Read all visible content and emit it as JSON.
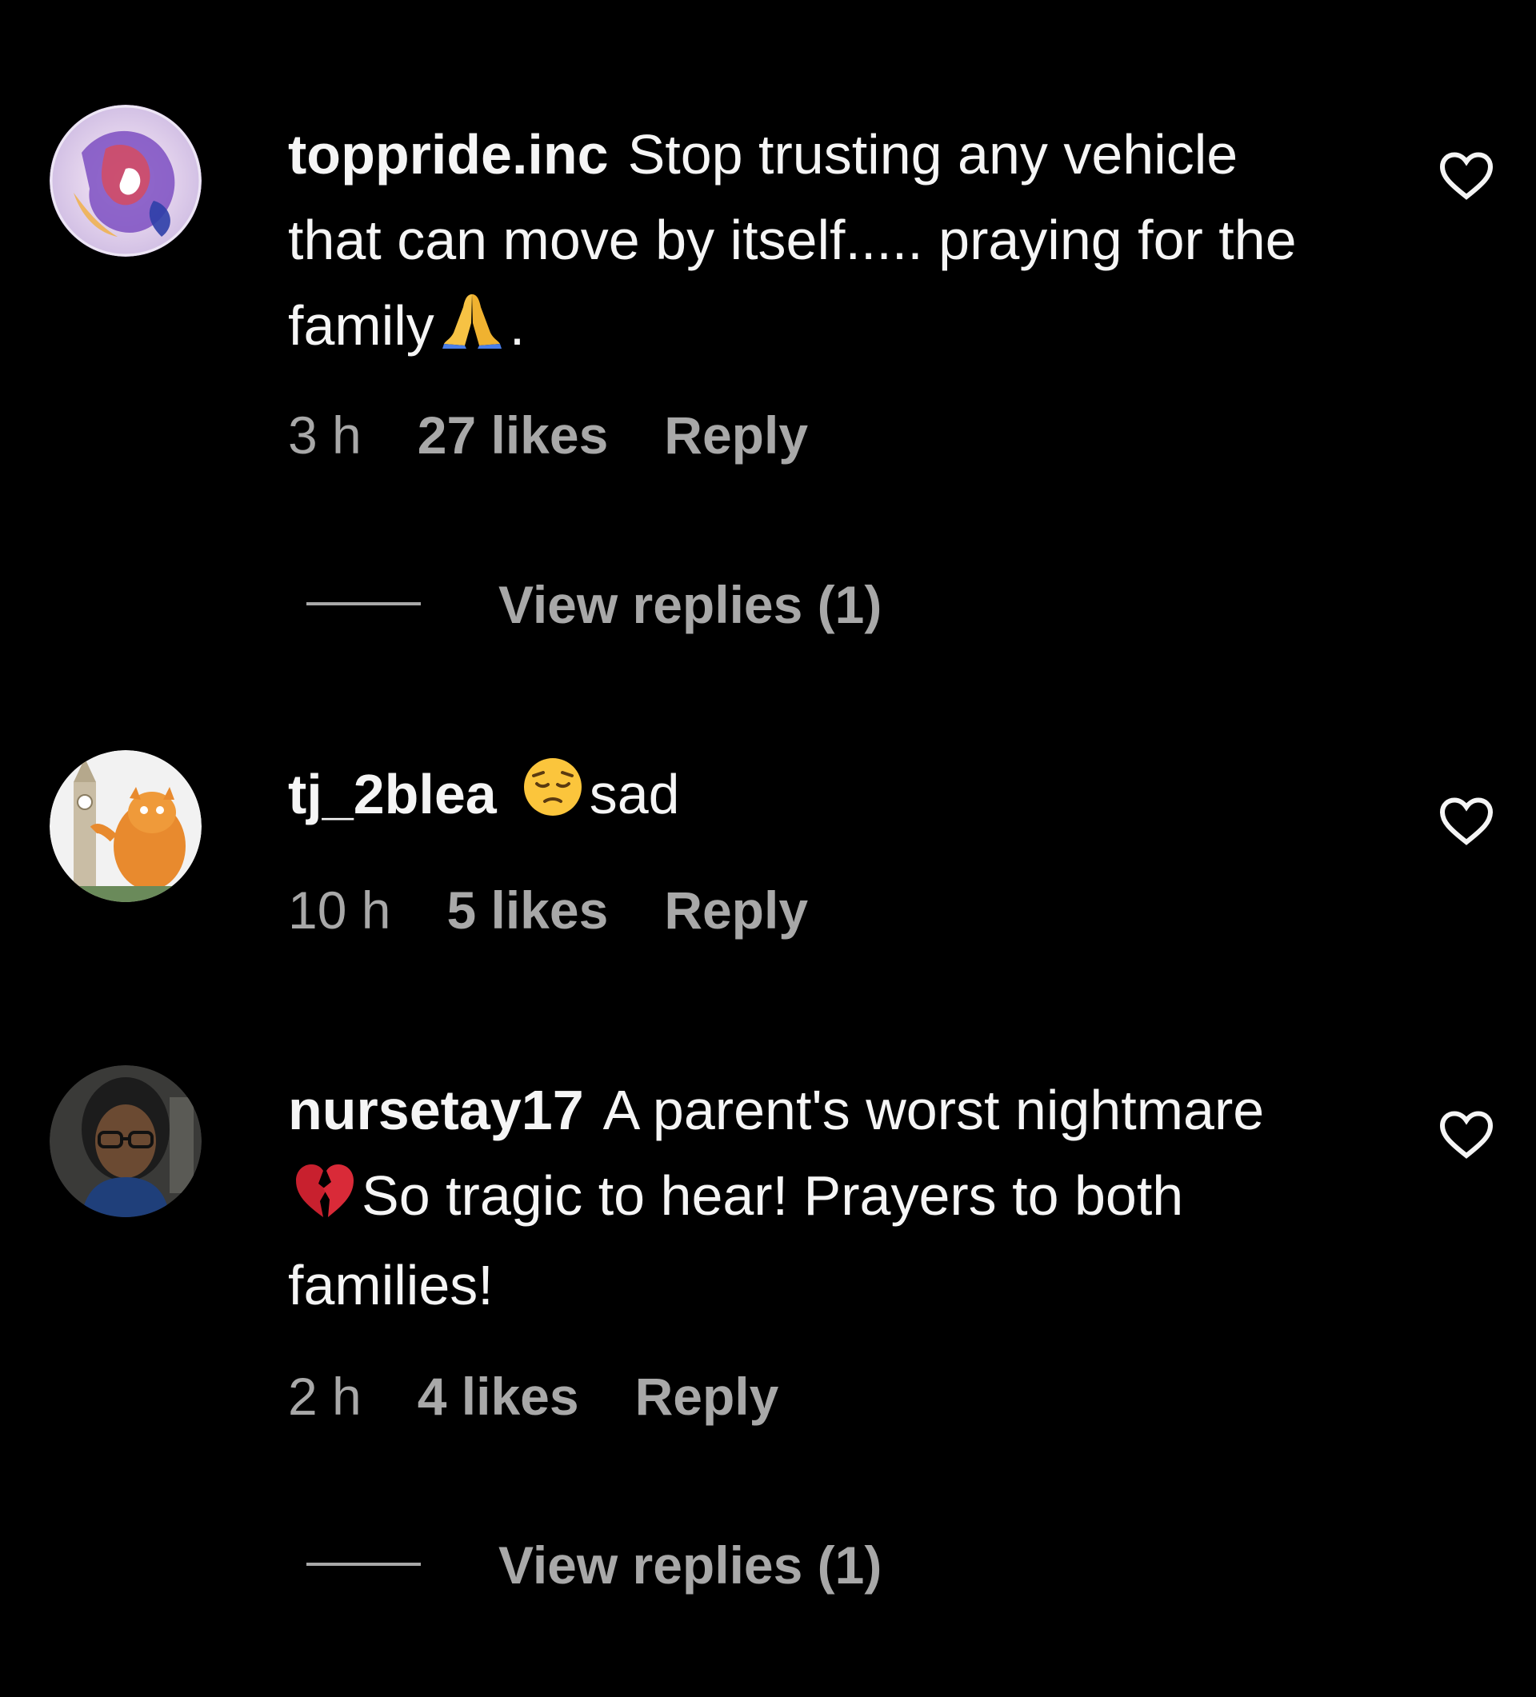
{
  "colors": {
    "background": "#000000",
    "primary_text": "#f5f5f5",
    "secondary_text": "#a8a8a8"
  },
  "comments": [
    {
      "username": "toppride.inc",
      "text_before_emoji": "Stop trusting any vehicle that can move by itself..... praying for the family",
      "emoji": "folded-hands",
      "text_after_emoji": ".",
      "time": "3 h",
      "likes": "27 likes",
      "reply_label": "Reply",
      "view_replies": "View replies (1)",
      "like_icon": "heart-outline-icon"
    },
    {
      "username": "tj_2blea",
      "text_before_emoji": "",
      "emoji": "pensive-face",
      "text_after_emoji": "sad",
      "time": "10 h",
      "likes": "5 likes",
      "reply_label": "Reply",
      "like_icon": "heart-outline-icon"
    },
    {
      "username": "nursetay17",
      "text_before_emoji": "A parent's worst nightmare",
      "emoji": "broken-heart",
      "text_after_emoji": "So tragic to hear! Prayers to both families!",
      "time": "2 h",
      "likes": "4 likes",
      "reply_label": "Reply",
      "view_replies": "View replies (1)",
      "like_icon": "heart-outline-icon"
    }
  ]
}
